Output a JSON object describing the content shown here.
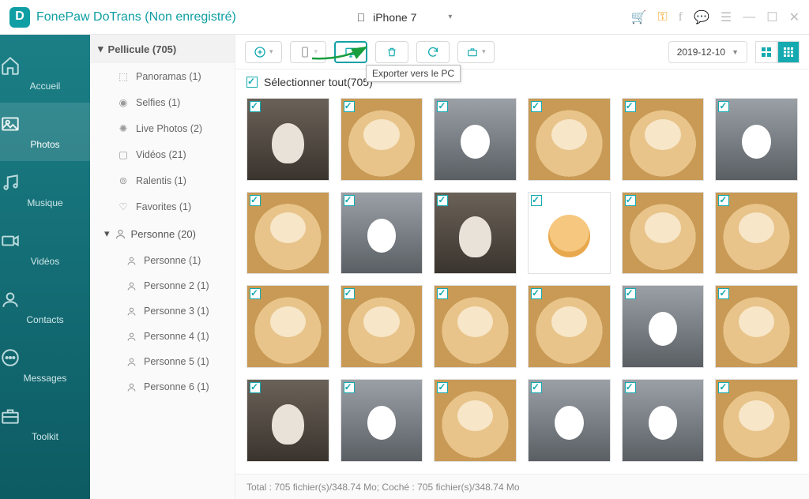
{
  "app": {
    "title": "FonePaw DoTrans (Non enregistré)"
  },
  "device": {
    "name": "iPhone 7"
  },
  "sidebar": {
    "items": [
      {
        "label": "Accueil",
        "icon": "home"
      },
      {
        "label": "Photos",
        "icon": "image"
      },
      {
        "label": "Musique",
        "icon": "music"
      },
      {
        "label": "Vidéos",
        "icon": "video"
      },
      {
        "label": "Contacts",
        "icon": "contact"
      },
      {
        "label": "Messages",
        "icon": "message"
      },
      {
        "label": "Toolkit",
        "icon": "toolkit"
      }
    ],
    "active": 1
  },
  "folders": {
    "header": "Pellicule (705)",
    "items": [
      {
        "label": "Panoramas (1)",
        "icon": "panorama"
      },
      {
        "label": "Selfies (1)",
        "icon": "selfie"
      },
      {
        "label": "Live Photos (2)",
        "icon": "live"
      },
      {
        "label": "Vidéos (21)",
        "icon": "video-cam"
      },
      {
        "label": "Ralentis (1)",
        "icon": "slowmo"
      },
      {
        "label": "Favorites (1)",
        "icon": "heart"
      }
    ],
    "personHeader": "Personne (20)",
    "persons": [
      {
        "label": "Personne (1)"
      },
      {
        "label": "Personne 2 (1)"
      },
      {
        "label": "Personne 3 (1)"
      },
      {
        "label": "Personne 4 (1)"
      },
      {
        "label": "Personne 5 (1)"
      },
      {
        "label": "Personne 6 (1)"
      }
    ]
  },
  "toolbar": {
    "tooltip": "Exporter vers le PC",
    "date": "2019-12-10"
  },
  "selectAll": {
    "label": "Sélectionner tout(705)",
    "checked": true
  },
  "thumbs": [
    {
      "c": "cat1"
    },
    {
      "c": "dog1"
    },
    {
      "c": "cat2"
    },
    {
      "c": "dog1"
    },
    {
      "c": "dog1"
    },
    {
      "c": "cat2"
    },
    {
      "c": "dog1"
    },
    {
      "c": "cat2"
    },
    {
      "c": "cat1"
    },
    {
      "c": "cartoon"
    },
    {
      "c": "dog1"
    },
    {
      "c": "dog1"
    },
    {
      "c": "dog1"
    },
    {
      "c": "dog1"
    },
    {
      "c": "dog1"
    },
    {
      "c": "dog1"
    },
    {
      "c": "cat2"
    },
    {
      "c": "dog1"
    },
    {
      "c": "cat1"
    },
    {
      "c": "cat2"
    },
    {
      "c": "dog1"
    },
    {
      "c": "cat2"
    },
    {
      "c": "cat2"
    },
    {
      "c": "dog1"
    }
  ],
  "status": {
    "text": "Total : 705 fichier(s)/348.74 Mo; Coché : 705 fichier(s)/348.74 Mo"
  }
}
